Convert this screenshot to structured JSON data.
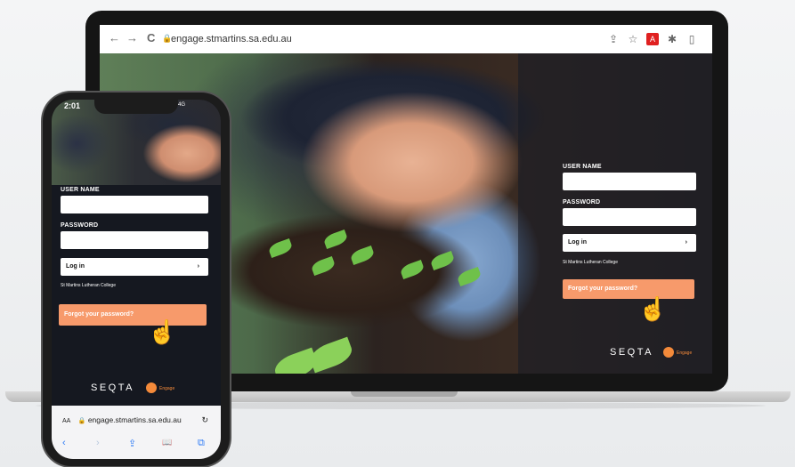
{
  "desktop": {
    "browser": {
      "url": "engage.stmartins.sa.edu.au",
      "nav_back": "←",
      "nav_forward": "→",
      "nav_reload": "C"
    },
    "login": {
      "username_label": "USER NAME",
      "password_label": "PASSWORD",
      "login_label": "Log in",
      "login_chevron": "›",
      "school_name": "St Martins Lutheran College",
      "forgot_label": "Forgot your password?"
    },
    "brand": {
      "logo": "SEQTA",
      "engage": "Engage"
    }
  },
  "mobile": {
    "status": {
      "time": "2:01",
      "network": "4G"
    },
    "login": {
      "username_label": "USER NAME",
      "password_label": "PASSWORD",
      "login_label": "Log in",
      "login_chevron": "›",
      "school_name": "St Martins Lutheran College",
      "forgot_label": "Forgot your password?"
    },
    "brand": {
      "logo": "SEQTA",
      "engage": "Engage"
    },
    "safari": {
      "text_size": "AA",
      "url": "engage.stmartins.sa.edu.au",
      "reload": "↻"
    },
    "toolbar": [
      "‹",
      "›",
      "⇪",
      "📖",
      "⧉"
    ]
  },
  "colors": {
    "accent": "#f79a6b",
    "engage": "#f48a3a",
    "panel": "#141a26"
  }
}
